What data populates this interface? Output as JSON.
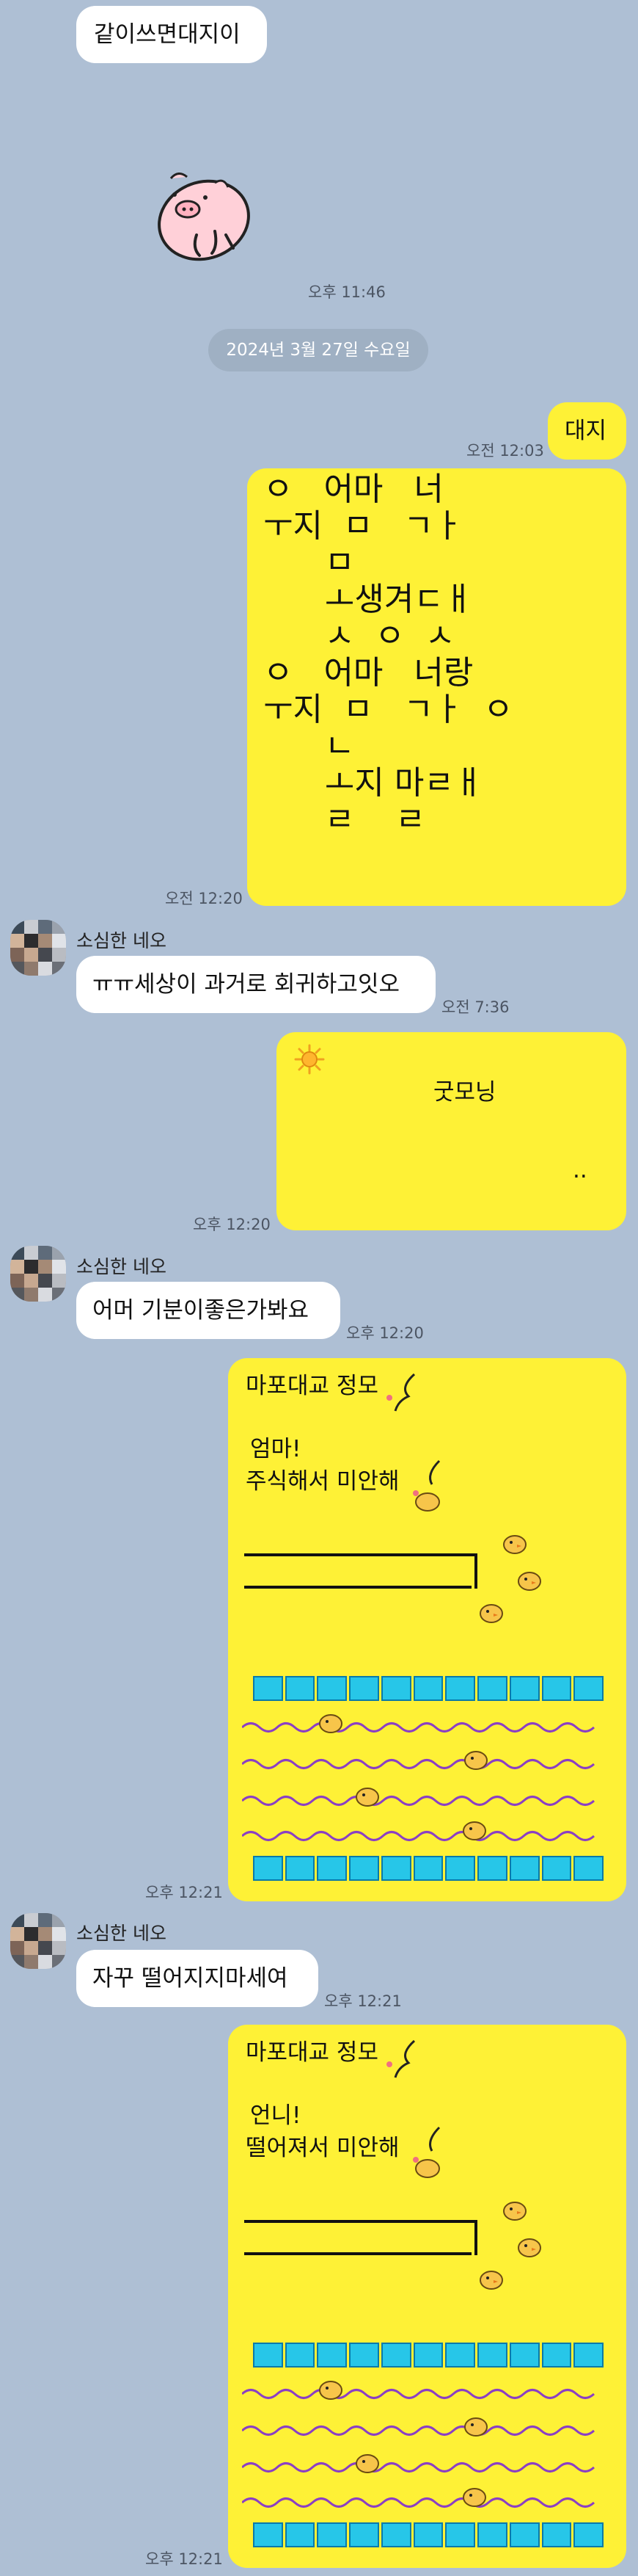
{
  "messages": {
    "m1": {
      "text": "같이쓰면대지이"
    },
    "m1_time": "오후 11:46",
    "date_divider": "2024년 3월 27일 수요일",
    "m2": {
      "text": "대지",
      "time": "오전 12:03"
    },
    "m3": {
      "lines": [
        "ㅇ   어마   너",
        "ㅜ지  ㅁ   ㄱㅏ",
        "",
        "      ㅁ",
        "      ㅗ생겨ㄷㅐ",
        "      ㅅ  ㅇ  ㅅ",
        "",
        "ㅇ   어마   너랑",
        "ㅜ지  ㅁ   ㄱㅏ  ㅇ",
        "",
        "      ㄴ",
        "      ㅗ지 마ㄹㅐ",
        "      ㄹ    ㄹ"
      ],
      "time": "오전 12:20"
    },
    "m4": {
      "sender": "소심한 네오",
      "text": "ㅠㅠ세상이 과거로 회귀하고잇오",
      "time": "오전 7:36"
    },
    "m5": {
      "icon": "sun-emoji",
      "title": "굿모닝",
      "dots": "..",
      "time": "오후 12:20"
    },
    "m6": {
      "sender": "소심한 네오",
      "text": "어머 기분이좋은가봐요",
      "time": "오후 12:20"
    },
    "m7": {
      "title": "마포대교 정모",
      "line1": "엄마!",
      "line2": "주식해서 미안해",
      "time": "오후 12:21"
    },
    "m8": {
      "sender": "소심한 네오",
      "text": "자꾸 떨어지지마세여",
      "time": "오후 12:21"
    },
    "m9": {
      "title": "마포대교 정모",
      "line1": "언니!",
      "line2": "떨어져서 미안해",
      "time": "오후 12:21"
    }
  },
  "colors": {
    "background": "#aebfd4",
    "my_bubble": "#fef136",
    "their_bubble": "#ffffff",
    "water": "#27c6e8",
    "wave": "#8b3fc4"
  }
}
